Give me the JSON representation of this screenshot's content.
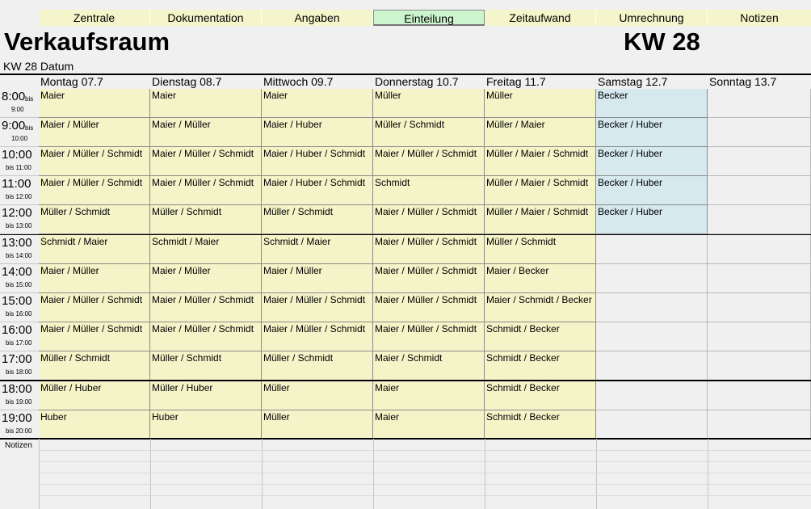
{
  "nav": {
    "tabs": [
      "Zentrale",
      "Dokumentation",
      "Angaben",
      "Einteilung",
      "Zeitaufwand",
      "Umrechnung",
      "Notizen"
    ],
    "active_index": 3
  },
  "header": {
    "title": "Verkaufsraum",
    "week": "KW 28",
    "date_label": "KW 28 Datum"
  },
  "days": [
    "Montag 07.7",
    "Dienstag 08.7",
    "Mittwoch 09.7",
    "Donnerstag 10.7",
    "Freitag 11.7",
    "Samstag 12.7",
    "Sonntag 13.7"
  ],
  "schedule": [
    {
      "time": "8:00",
      "bis": "bis",
      "until": "9:00",
      "cells": [
        "Maier",
        "Maier",
        "Maier",
        "Müller",
        "Müller",
        "Becker",
        ""
      ]
    },
    {
      "time": "9:00",
      "bis": "bis",
      "until": "10:00",
      "cells": [
        "Maier / Müller",
        "Maier / Müller",
        "Maier / Huber",
        "Müller / Schmidt",
        "Müller / Maier",
        "Becker / Huber",
        ""
      ]
    },
    {
      "time": "10:00",
      "bis": "",
      "until": "bis 11:00",
      "cells": [
        "Maier / Müller / Schmidt",
        "Maier / Müller / Schmidt",
        "Maier / Huber / Schmidt",
        "Maier / Müller / Schmidt",
        "Müller / Maier / Schmidt",
        "Becker / Huber",
        ""
      ]
    },
    {
      "time": "11:00",
      "bis": "",
      "until": "bis 12:00",
      "cells": [
        "Maier / Müller / Schmidt",
        "Maier / Müller / Schmidt",
        "Maier / Huber / Schmidt",
        "Schmidt",
        "Müller / Maier / Schmidt",
        "Becker / Huber",
        ""
      ]
    },
    {
      "time": "12:00",
      "bis": "",
      "until": "bis 13:00",
      "cells": [
        "Müller / Schmidt",
        "Müller / Schmidt",
        "Müller / Schmidt",
        "Maier / Müller / Schmidt",
        "Müller / Maier / Schmidt",
        "Becker / Huber",
        ""
      ]
    },
    {
      "time": "13:00",
      "bis": "",
      "until": "bis 14:00",
      "cells": [
        "Schmidt / Maier",
        "Schmidt / Maier",
        "Schmidt / Maier",
        "Maier / Müller / Schmidt",
        "Müller / Schmidt",
        "",
        ""
      ]
    },
    {
      "time": "14:00",
      "bis": "",
      "until": "bis 15:00",
      "cells": [
        "Maier / Müller",
        "Maier / Müller",
        "Maier / Müller",
        "Maier / Müller / Schmidt",
        "Maier / Becker",
        "",
        ""
      ]
    },
    {
      "time": "15:00",
      "bis": "",
      "until": "bis 16:00",
      "cells": [
        "Maier / Müller / Schmidt",
        "Maier / Müller / Schmidt",
        "Maier / Müller / Schmidt",
        "Maier / Müller / Schmidt",
        "Maier / Schmidt / Becker",
        "",
        ""
      ]
    },
    {
      "time": "16:00",
      "bis": "",
      "until": "bis 17:00",
      "cells": [
        "Maier / Müller / Schmidt",
        "Maier / Müller / Schmidt",
        "Maier / Müller / Schmidt",
        "Maier / Müller / Schmidt",
        "Schmidt / Becker",
        "",
        ""
      ]
    },
    {
      "time": "17:00",
      "bis": "",
      "until": "bis 18:00",
      "cells": [
        "Müller / Schmidt",
        "Müller / Schmidt",
        "Müller / Schmidt",
        "Maier / Schmidt",
        "Schmidt / Becker",
        "",
        ""
      ]
    },
    {
      "time": "18:00",
      "bis": "",
      "until": "bis 19:00",
      "cells": [
        "Müller / Huber",
        "Müller / Huber",
        "Müller",
        "Maier",
        "Schmidt / Becker",
        "",
        ""
      ]
    },
    {
      "time": "19:00",
      "bis": "",
      "until": "bis 20:00",
      "cells": [
        "Huber",
        "Huber",
        "Müller",
        "Maier",
        "Schmidt / Becker",
        "",
        ""
      ]
    }
  ],
  "notes_label": "Notizen",
  "colors": {
    "weekday_cell": "#f4f4c8",
    "saturday_cell": "#d5e9ef",
    "active_tab": "#cdf5cd",
    "inactive_tab": "#f5f5cc"
  }
}
